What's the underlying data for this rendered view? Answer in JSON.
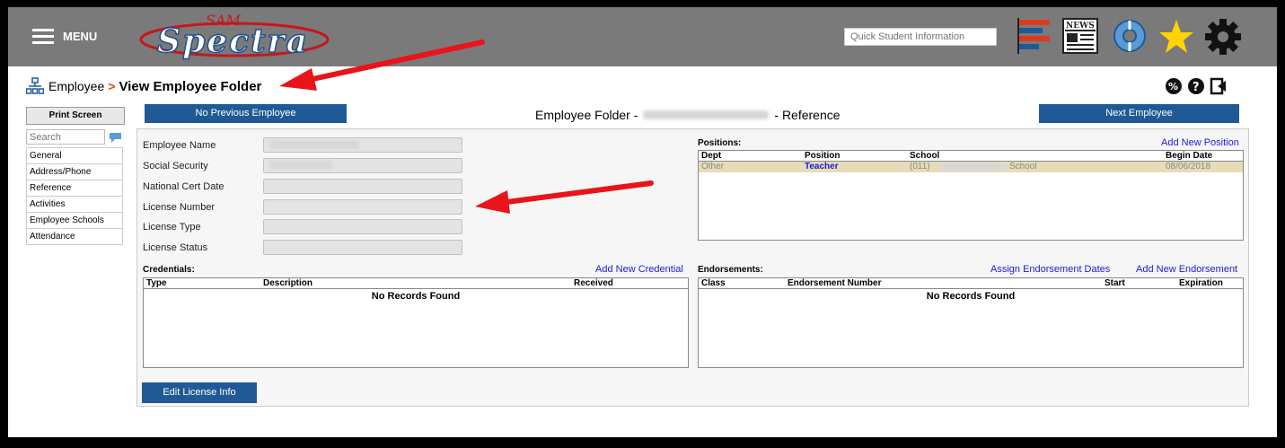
{
  "header": {
    "menu_label": "MENU",
    "logo_small": "SAM",
    "logo_main": "Spectra",
    "quick_student_placeholder": "Quick Student Information",
    "icons": [
      "bar-chart-icon",
      "news-icon",
      "life-ring-icon",
      "star-icon",
      "gear-icon"
    ],
    "news_label": "NEWS"
  },
  "breadcrumb": {
    "parent": "Employee",
    "separator": ">",
    "current": "View Employee Folder"
  },
  "sidebar": {
    "print_label": "Print Screen",
    "search_placeholder": "Search",
    "items": [
      "General",
      "Address/Phone",
      "Reference",
      "Activities",
      "Employee Schools",
      "Attendance"
    ]
  },
  "nav": {
    "prev_label": "No Previous Employee",
    "next_label": "Next Employee",
    "title_prefix": "Employee Folder -",
    "title_suffix": "- Reference"
  },
  "fields": [
    {
      "label": "Employee Name",
      "value": ""
    },
    {
      "label": "Social Security",
      "value": ""
    },
    {
      "label": "National Cert Date",
      "value": ""
    },
    {
      "label": "License Number",
      "value": ""
    },
    {
      "label": "License Type",
      "value": ""
    },
    {
      "label": "License Status",
      "value": ""
    }
  ],
  "positions": {
    "title": "Positions:",
    "add_link": "Add New Position",
    "columns": [
      "Dept",
      "Position",
      "School",
      "Begin Date"
    ],
    "rows": [
      {
        "dept": "Other",
        "position": "Teacher",
        "school_prefix": "(011)",
        "school_suffix": "School",
        "begin_date": "08/06/2018"
      }
    ]
  },
  "credentials": {
    "title": "Credentials:",
    "add_link": "Add New Credential",
    "columns": [
      "Type",
      "Description",
      "Received"
    ],
    "empty_text": "No Records Found"
  },
  "endorsements": {
    "title": "Endorsements:",
    "assign_link": "Assign Endorsement Dates",
    "add_link": "Add New Endorsement",
    "columns": [
      "Class",
      "Endorsement Number",
      "Start",
      "Expiration"
    ],
    "empty_text": "No Records Found"
  },
  "edit_license_label": "Edit License Info",
  "colors": {
    "topbar": "#7a7a7a",
    "button_blue": "#1f5a96",
    "link_blue": "#1a1ae0",
    "annotation_red": "#e8141a",
    "selected_row": "#e6dcb8"
  }
}
